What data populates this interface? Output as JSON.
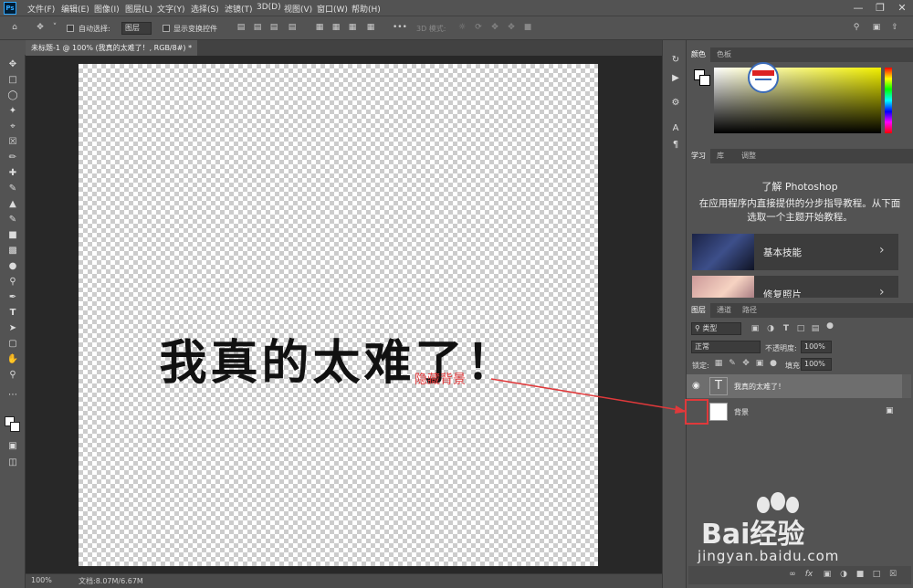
{
  "app": {
    "logo": "Ps"
  },
  "menu": [
    "文件(F)",
    "编辑(E)",
    "图像(I)",
    "图层(L)",
    "文字(Y)",
    "选择(S)",
    "滤镜(T)",
    "3D(D)",
    "视图(V)",
    "窗口(W)",
    "帮助(H)"
  ],
  "options": {
    "auto_select_label": "自动选择:",
    "auto_select_value": "图层",
    "show_transform_label": "显示变换控件",
    "mode_3d_label": "3D 模式:"
  },
  "document": {
    "tab_title": "未标题-1 @ 100% (我真的太难了！, RGB/8#) *",
    "canvas_text": "我真的太难了！",
    "zoom": "100%",
    "doc_size": "文档:8.07M/6.67M"
  },
  "annotation": {
    "label": "隐藏背景",
    "color": "#e0393b"
  },
  "color_panel": {
    "tabs": [
      "颜色",
      "色板"
    ],
    "foreground": "#ffffff",
    "background": "#000000"
  },
  "learn_panel": {
    "tabs": [
      "学习",
      "库",
      "调整"
    ],
    "title": "了解 Photoshop",
    "description": "在应用程序内直接提供的分步指导教程。从下面选取一个主题开始教程。",
    "cards": [
      "基本技能",
      "修复照片"
    ]
  },
  "layers_panel": {
    "tabs": [
      "图层",
      "通道",
      "路径"
    ],
    "filter_label": "类型",
    "blend_mode": "正常",
    "opacity_label": "不透明度:",
    "opacity_value": "100%",
    "lock_label": "锁定:",
    "fill_label": "填充:",
    "fill_value": "100%",
    "layers": [
      {
        "name": "我真的太难了！",
        "type": "text",
        "visible": true
      },
      {
        "name": "背景",
        "type": "background",
        "visible": false,
        "locked": true
      }
    ]
  },
  "watermark": {
    "brand": "Bai经验",
    "url": "jingyan.baidu.com"
  }
}
